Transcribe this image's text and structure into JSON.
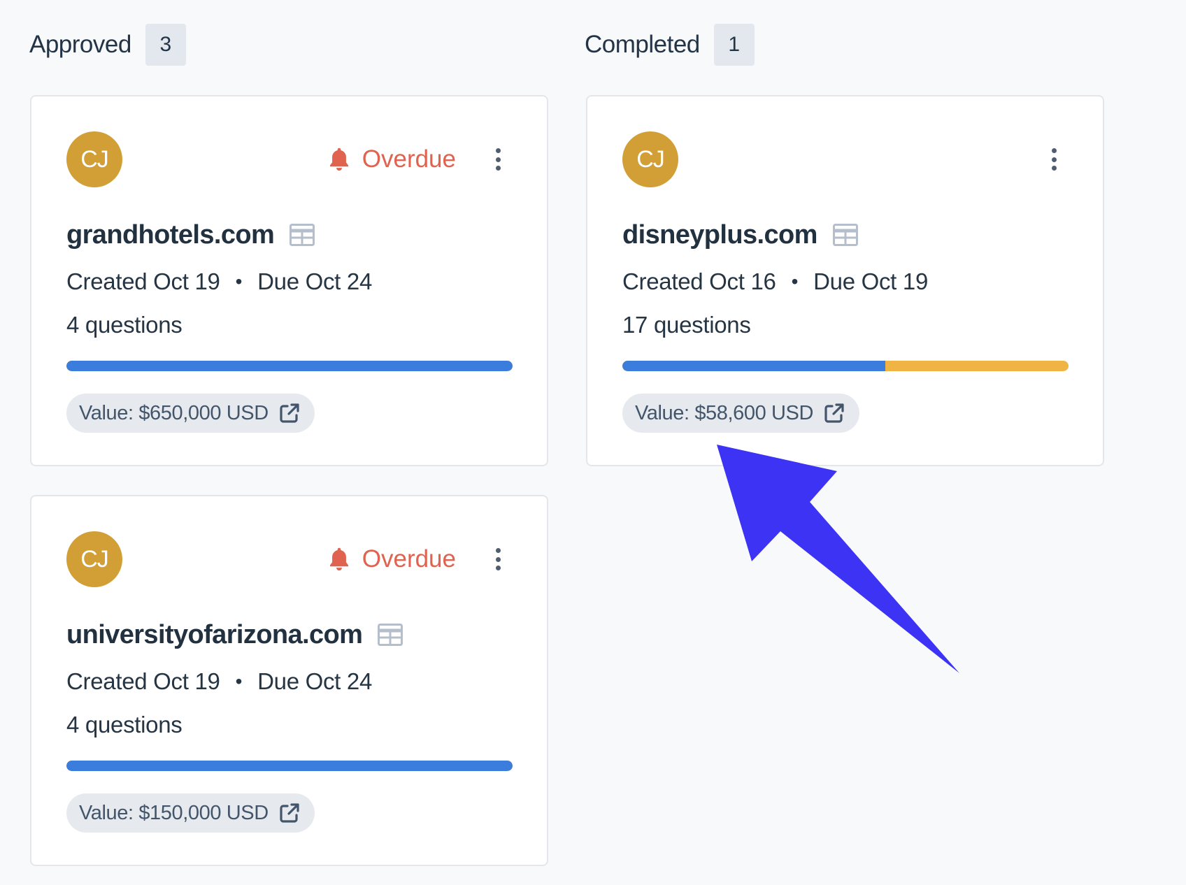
{
  "columns": [
    {
      "title": "Approved",
      "count": "3"
    },
    {
      "title": "Completed",
      "count": "1"
    }
  ],
  "cards": [
    {
      "avatar": "CJ",
      "status": "Overdue",
      "domain": "grandhotels.com",
      "created": "Created Oct 19",
      "separator": "•",
      "due": "Due Oct 24",
      "questions": "4 questions",
      "progress_completed": 1.0,
      "value": "Value: $650,000 USD"
    },
    {
      "avatar": "CJ",
      "status": "Overdue",
      "domain": "universityofarizona.com",
      "created": "Created Oct 19",
      "separator": "•",
      "due": "Due Oct 24",
      "questions": "4 questions",
      "progress_completed": 1.0,
      "value": "Value: $150,000 USD"
    },
    {
      "avatar": "CJ",
      "status": "",
      "domain": "disneyplus.com",
      "created": "Created Oct 16",
      "separator": "•",
      "due": "Due Oct 19",
      "questions": "17 questions",
      "progress_completed": 0.59,
      "value": "Value: $58,600 USD"
    }
  ],
  "colors": {
    "avatar": "#d29f37",
    "overdue": "#e0634f",
    "progress_done": "#3b7ddd",
    "progress_remaining": "#f0b444",
    "annotation_arrow": "#3d33f4"
  },
  "icons": {
    "status": "bell-icon",
    "menu": "kebab-menu-icon",
    "domain": "table-icon",
    "value_link": "external-link-icon"
  }
}
